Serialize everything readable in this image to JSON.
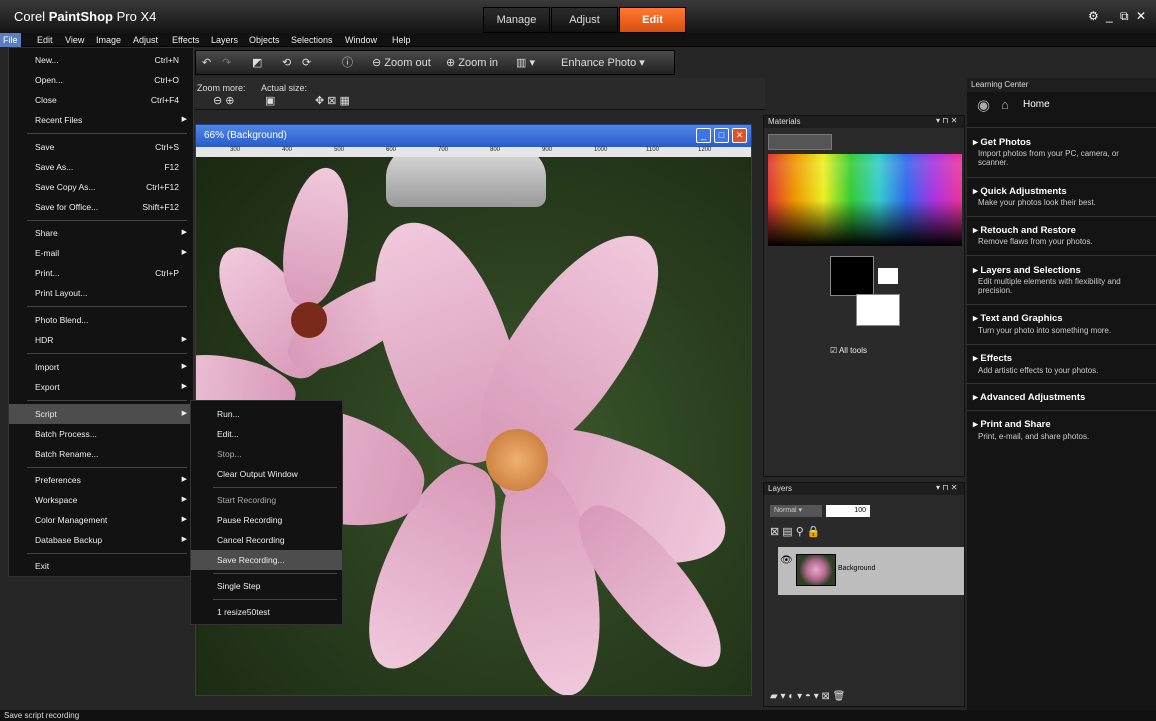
{
  "app": {
    "title_brand": "Corel",
    "title_name": "PaintShop",
    "title_ver": "Pro X4",
    "controls": "⚙ _ ⧉ ✕"
  },
  "tabs": [
    {
      "label": "Manage"
    },
    {
      "label": "Adjust"
    },
    {
      "label": "Edit"
    }
  ],
  "menubar": [
    "File",
    "Edit",
    "View",
    "Image",
    "Adjust",
    "Effects",
    "Layers",
    "Objects",
    "Selections",
    "Window",
    "Help"
  ],
  "toolbar": {
    "zoom_out": "Zoom out",
    "zoom_in": "Zoom in",
    "enhance": "Enhance Photo ▾",
    "zoom_more": "Zoom more:",
    "actual_size": "Actual size:"
  },
  "image_window": {
    "title": "66% (Background)",
    "ruler": [
      "300",
      "400",
      "500",
      "600",
      "700",
      "800",
      "900",
      "1000",
      "1100",
      "1200"
    ]
  },
  "file_menu": [
    {
      "label": "New...",
      "shortcut": "Ctrl+N"
    },
    {
      "label": "Open...",
      "shortcut": "Ctrl+O"
    },
    {
      "label": "Close",
      "shortcut": "Ctrl+F4"
    },
    {
      "label": "Recent Files",
      "shortcut": "▶"
    },
    {
      "label": "Save",
      "shortcut": "Ctrl+S"
    },
    {
      "label": "Save As...",
      "shortcut": "F12"
    },
    {
      "label": "Save Copy As...",
      "shortcut": "Ctrl+F12"
    },
    {
      "label": "Save for Office...",
      "shortcut": "Shift+F12"
    },
    {
      "label": "Share",
      "shortcut": "▶"
    },
    {
      "label": "E-mail",
      "shortcut": "▶"
    },
    {
      "label": "Print...",
      "shortcut": "Ctrl+P"
    },
    {
      "label": "Print Layout...",
      "shortcut": ""
    },
    {
      "label": "Photo Blend...",
      "shortcut": ""
    },
    {
      "label": "HDR",
      "shortcut": "▶"
    },
    {
      "label": "Import",
      "shortcut": "▶"
    },
    {
      "label": "Export",
      "shortcut": "▶"
    },
    {
      "label": "Script",
      "shortcut": "▶"
    },
    {
      "label": "Batch Process...",
      "shortcut": ""
    },
    {
      "label": "Batch Rename...",
      "shortcut": ""
    },
    {
      "label": "Preferences",
      "shortcut": "▶"
    },
    {
      "label": "Workspace",
      "shortcut": "▶"
    },
    {
      "label": "Color Management",
      "shortcut": "▶"
    },
    {
      "label": "Database Backup",
      "shortcut": "▶"
    },
    {
      "label": "Exit",
      "shortcut": ""
    }
  ],
  "script_menu": [
    "Run...",
    "Edit...",
    "Stop...",
    "Clear Output Window",
    "Start Recording",
    "Pause Recording",
    "Cancel Recording",
    "Save Recording...",
    "Single Step",
    "1 resize50test"
  ],
  "materials": {
    "title": "Materials",
    "all_tools": "All tools"
  },
  "layers": {
    "title": "Layers",
    "blend": "Normal",
    "opacity": "100",
    "layer_name": "Background"
  },
  "learning": {
    "title": "Learning Center",
    "home": "Home",
    "items": [
      {
        "title": "▸ Get Photos",
        "desc": "Import photos from your PC, camera, or scanner."
      },
      {
        "title": "▸ Quick Adjustments",
        "desc": "Make your photos look their best."
      },
      {
        "title": "▸ Retouch and Restore",
        "desc": "Remove flaws from your photos."
      },
      {
        "title": "▸ Layers and Selections",
        "desc": "Edit multiple elements with flexibility and precision."
      },
      {
        "title": "▸ Text and Graphics",
        "desc": "Turn your photo into something more."
      },
      {
        "title": "▸ Effects",
        "desc": "Add artistic effects to your photos."
      },
      {
        "title": "▸ Advanced Adjustments",
        "desc": ""
      },
      {
        "title": "▸ Print and Share",
        "desc": "Print, e-mail, and share photos."
      }
    ]
  },
  "status": "Save script recording"
}
